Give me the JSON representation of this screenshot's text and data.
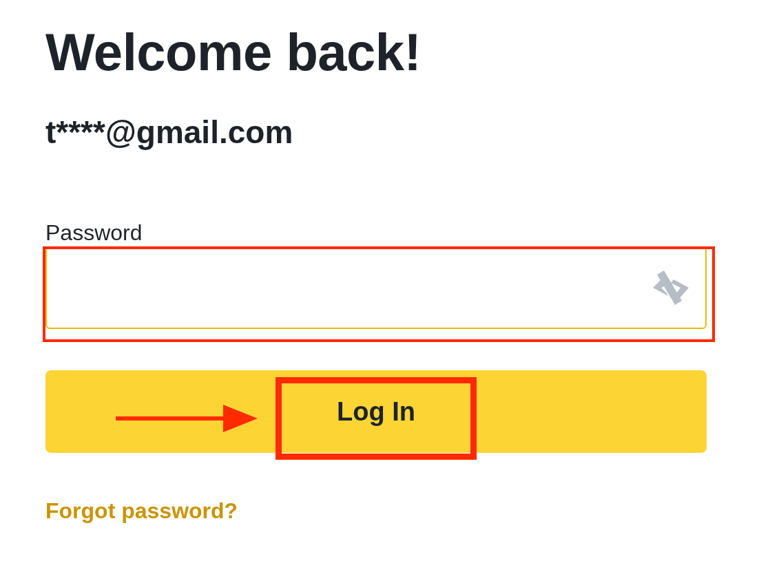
{
  "title": "Welcome back!",
  "account": "t****@gmail.com",
  "password_field": {
    "label": "Password"
  },
  "login_button": {
    "label": "Log In"
  },
  "forgot_link": "Forgot password?"
}
